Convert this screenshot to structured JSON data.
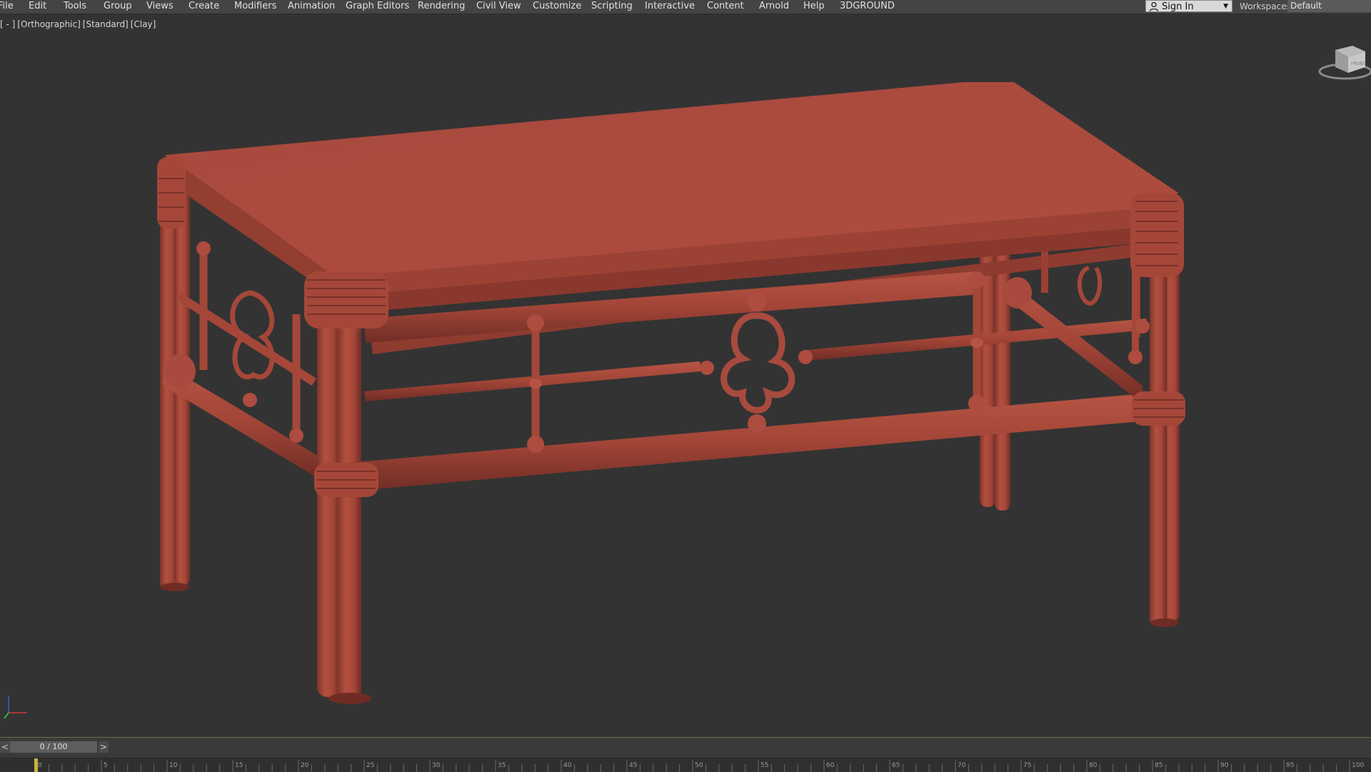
{
  "menubar": {
    "items": [
      "File",
      "Edit",
      "Tools",
      "Group",
      "Views",
      "Create",
      "Modifiers",
      "Animation",
      "Graph Editors",
      "Rendering",
      "Civil View",
      "Customize",
      "Scripting",
      "Interactive",
      "Content",
      "Arnold",
      "Help",
      "3DGROUND"
    ],
    "signin_label": "Sign In",
    "workspaces_label": "Workspaces:",
    "workspace_value": "Default"
  },
  "viewport": {
    "labels": [
      "[ - ]",
      "[Orthographic]",
      "[Standard]",
      "[Clay]"
    ],
    "model_color": "#a84a3e",
    "background_color": "#333333",
    "viewcube_face": "FRONT"
  },
  "timeline": {
    "prev_label": "<",
    "next_label": ">",
    "frame_display": "0 / 100",
    "ticks": [
      0,
      5,
      10,
      15,
      20,
      25,
      30,
      35,
      40,
      45,
      50,
      55,
      60,
      65,
      70,
      75,
      80,
      85,
      90,
      95,
      100
    ]
  }
}
